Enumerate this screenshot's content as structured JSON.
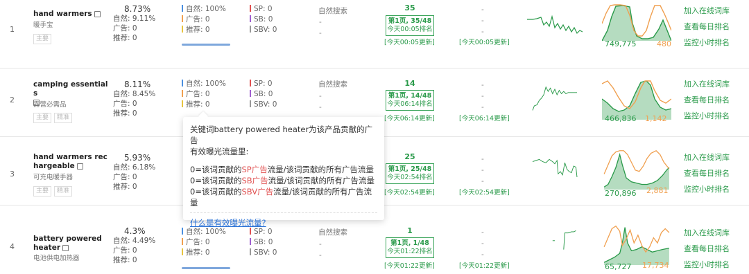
{
  "rows": [
    {
      "num": "1",
      "keyword": "hand warmers",
      "cn": "暖手宝",
      "tags": [
        "主要"
      ],
      "share": "8.73%",
      "natural_pct": "自然: 9.11%",
      "ad": "广告: 0",
      "rec": "推荐: 0",
      "m1": "自然: 100%",
      "m2": "广告: 0",
      "m3": "推荐: 0",
      "sp": "SP: 0",
      "sb": "SB: 0",
      "sbv": "SBV: 0",
      "src": "自然搜索",
      "rank": "35",
      "rank_page": "第1页, 35/48",
      "rank_time": "今天00:05排名",
      "rank_upd": "[今天00:05更新]",
      "upd2": "[今天00:05更新]",
      "v1": "749,775",
      "v2": "480"
    },
    {
      "num": "2",
      "keyword": "camping essentials",
      "cn": "露营必需品",
      "tags": [
        "主要",
        "精准"
      ],
      "share": "8.11%",
      "natural_pct": "自然: 8.45%",
      "ad": "广告: 0",
      "rec": "推荐: 0",
      "m1": "自然: 100%",
      "m2": "广告: 0",
      "m3": "推荐: 0",
      "sp": "SP: 0",
      "sb": "SB: 0",
      "sbv": "SBV: 0",
      "src": "自然搜索",
      "rank": "14",
      "rank_page": "第1页, 14/48",
      "rank_time": "今天06:14排名",
      "rank_upd": "[今天06:14更新]",
      "upd2": "[今天06:14更新]",
      "v1": "466,836",
      "v2": "1,142"
    },
    {
      "num": "3",
      "keyword": "hand warmers rechargeable",
      "cn": "可充电暖手器",
      "tags": [
        "主要",
        "精准"
      ],
      "share": "5.93%",
      "natural_pct": "自然: 6.18%",
      "ad": "广告: 0",
      "rec": "推荐: 0",
      "m1": "0=该词贡献的",
      "m2": "",
      "m3": "",
      "sp": "",
      "sb": "",
      "sbv": "",
      "src": "",
      "rank": "25",
      "rank_page": "第1页, 25/48",
      "rank_time": "今天02:54排名",
      "rank_upd": "[今天02:54更新]",
      "upd2": "[今天02:54更新]",
      "v1": "270,896",
      "v2": "2,881"
    },
    {
      "num": "4",
      "keyword": "battery powered heater",
      "cn": "电池供电加热器",
      "tags": [],
      "share": "4.3%",
      "natural_pct": "自然: 4.49%",
      "ad": "广告: 0",
      "rec": "推荐: 0",
      "m1": "自然: 100%",
      "m2": "广告: 0",
      "m3": "推荐: 0",
      "sp": "SP: 0",
      "sb": "SB: 0",
      "sbv": "SBV: 0",
      "src": "自然搜索",
      "rank": "1",
      "rank_page": "第1页, 1/48",
      "rank_time": "今天01:22排名",
      "rank_upd": "[今天01:22更新]",
      "upd2": "[今天01:22更新]",
      "v1": "65,727",
      "v2": "17,734"
    }
  ],
  "actions": [
    "加入在线词库",
    "查看每日排名",
    "监控小时排名"
  ],
  "tooltip": {
    "title_1": "关键词battery powered heater为该产品贡献的广告",
    "title_2": "有效曝光流量里:",
    "l1_pre": "0=该词贡献的",
    "l1_sp": "SP广告",
    "l1_post": "流量/该词贡献的所有广告流量",
    "l2_pre": "0=该词贡献的",
    "l2_sp": "SB广告",
    "l2_post": "流量/该词贡献的所有广告流量",
    "l3_pre": "0=该词贡献的",
    "l3_sp": "SBV广告",
    "l3_post": "流量/该词贡献的所有广告流量",
    "link": "什么是有效曝光流量?"
  },
  "dash": "-",
  "colors": {
    "green": "#2a9a4a",
    "orange": "#f0a050",
    "blue": "#4a8fe0"
  }
}
